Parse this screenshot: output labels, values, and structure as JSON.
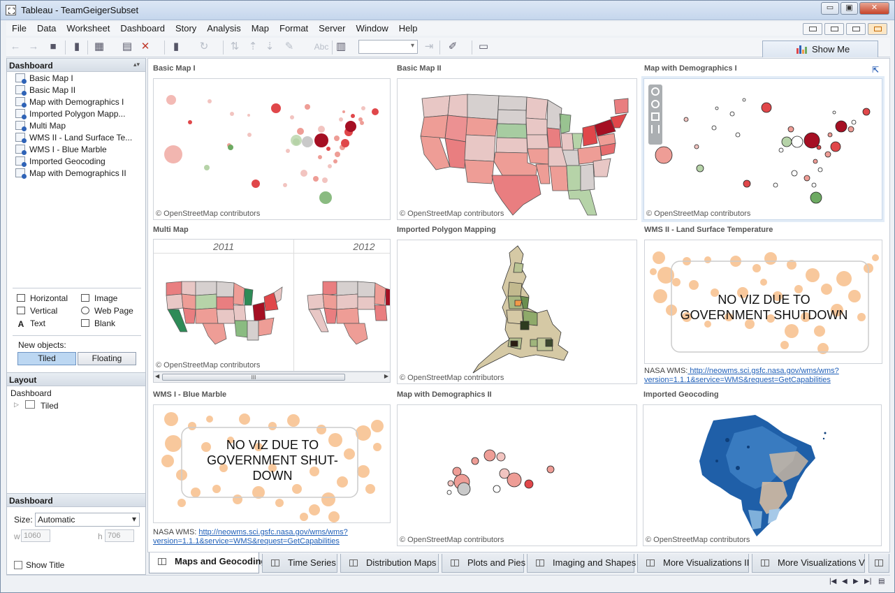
{
  "window": {
    "title": "Tableau - TeamGeigerSubset",
    "minimize": "▭",
    "restore": "▣",
    "close": "✕"
  },
  "menu": [
    "File",
    "Data",
    "Worksheet",
    "Dashboard",
    "Story",
    "Analysis",
    "Map",
    "Format",
    "Server",
    "Window",
    "Help"
  ],
  "toolbar": {
    "format_abc": "Abc",
    "show_me": "Show Me"
  },
  "dashboard_pane": {
    "header": "Dashboard",
    "sheets": [
      "Basic Map I",
      "Basic Map II",
      "Map with Demographics I",
      "Imported Polygon Mapp...",
      "Multi Map",
      "WMS II - Land Surface Te...",
      "WMS I - Blue Marble",
      "Imported Geocoding",
      "Map with Demographics II"
    ],
    "objects": [
      "Horizontal",
      "Image",
      "Vertical",
      "Web Page",
      "Text",
      "Blank"
    ],
    "new_objects_label": "New objects:",
    "tiled": "Tiled",
    "floating": "Floating"
  },
  "layout_pane": {
    "header": "Layout",
    "root": "Dashboard",
    "child": "Tiled"
  },
  "size_pane": {
    "header": "Dashboard",
    "size_label": "Size:",
    "size_value": "Automatic",
    "w_label": "w",
    "w_value": "1060",
    "h_label": "h",
    "h_value": "706",
    "show_title": "Show Title"
  },
  "panes": {
    "basic_map_1": {
      "title": "Basic Map I",
      "credit": "© OpenStreetMap contributors"
    },
    "basic_map_2": {
      "title": "Basic Map II",
      "credit": "© OpenStreetMap contributors"
    },
    "demographics_1": {
      "title": "Map with Demographics I",
      "credit": "© OpenStreetMap contributors"
    },
    "multi_map": {
      "title": "Multi Map",
      "year1": "2011",
      "year2": "2012",
      "credit": "© OpenStreetMap contributors",
      "scroll_grip": "III"
    },
    "polygon": {
      "title": "Imported Polygon Mapping",
      "credit": "© OpenStreetMap contributors"
    },
    "wms2": {
      "title": "WMS II - Land Surface Temperature",
      "overlay_line1": "NO VIZ DUE TO",
      "overlay_line2": "GOVERNMENT SHUTDOWN",
      "nasa_prefix": "NASA WMS:",
      "nasa_link1": " http://neowms.sci.gsfc.nasa.gov/wms/wms?",
      "nasa_link2": "version=1.1.1&service=WMS&request=GetCapabilities"
    },
    "wms1": {
      "title": "WMS I - Blue Marble",
      "overlay_line1": "NO VIZ DUE TO",
      "overlay_line2": "GOVERNMENT SHUT-",
      "overlay_line3": "DOWN",
      "nasa_prefix": "NASA WMS:",
      "nasa_link1": "http://neowms.sci.gsfc.nasa.gov/wms/wms?",
      "nasa_link2": "version=1.1.1&service=WMS&request=GetCapabilities"
    },
    "demographics_2": {
      "title": "Map with Demographics II",
      "credit": "© OpenStreetMap contributors"
    },
    "geocoding": {
      "title": "Imported Geocoding",
      "credit": "© OpenStreetMap contributors"
    }
  },
  "tabs": [
    "Maps and Geocoding",
    "Time Series",
    "Distribution Maps",
    "Plots and Pies",
    "Imaging and Shapes",
    "More Visualizations II",
    "More Visualizations V"
  ],
  "colors": {
    "dark_red": "#a50f23",
    "red": "#e0474a",
    "salmon": "#ee9d96",
    "pink": "#f2c4c0",
    "grey": "#c9c9c9",
    "green": "#6daa62",
    "light_green": "#b6d3a8",
    "orange": "#f29a4a",
    "blue": "#1f5fa8"
  }
}
